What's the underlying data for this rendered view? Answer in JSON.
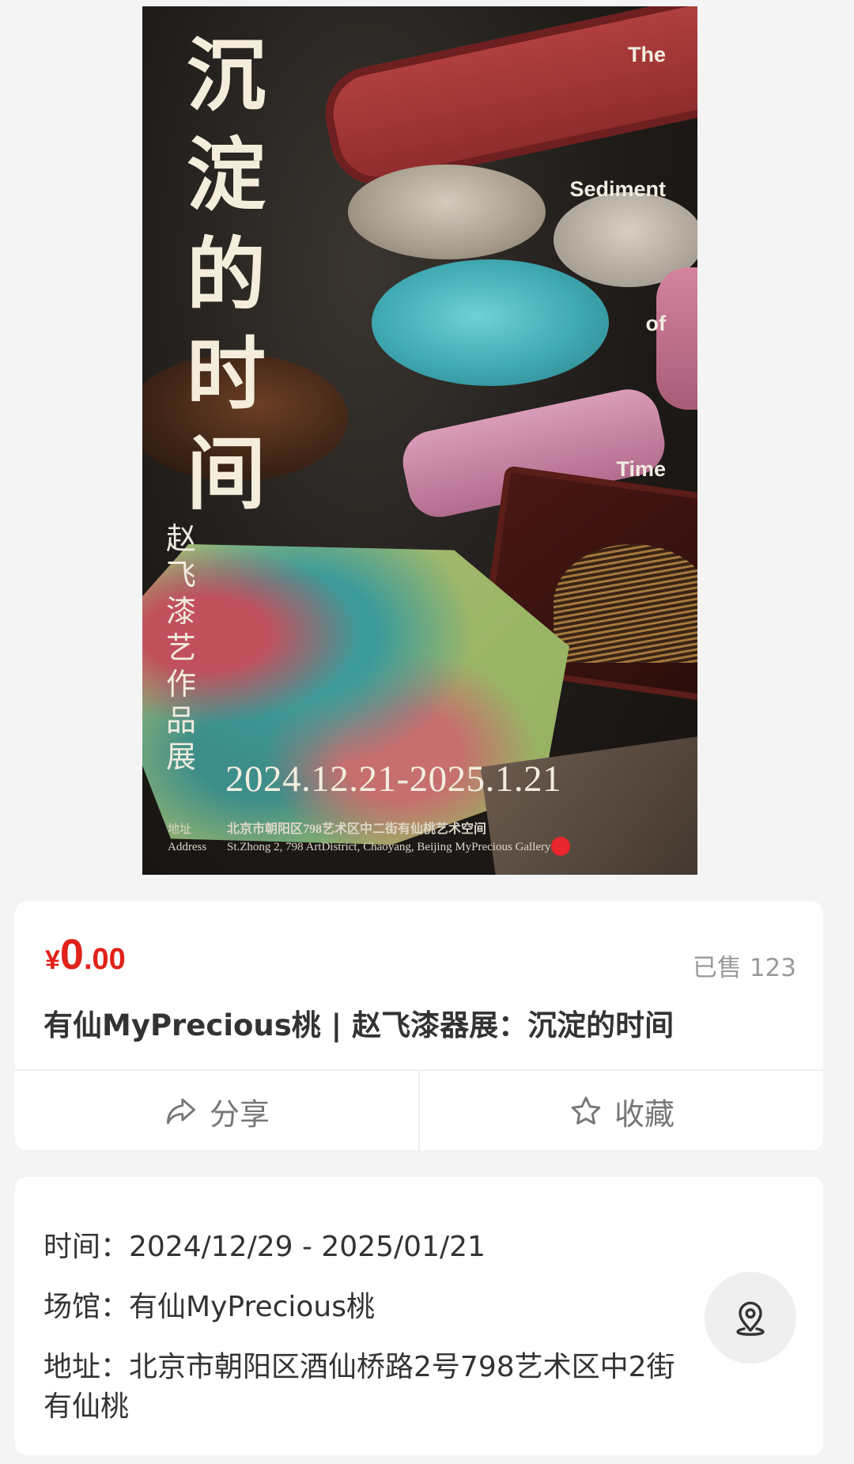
{
  "poster": {
    "title_cn": [
      "沉",
      "淀",
      "的",
      "时",
      "间"
    ],
    "title_en": [
      "The",
      "Sediment",
      "of",
      "Time"
    ],
    "artist": [
      "赵",
      "飞",
      "漆",
      "艺",
      "作",
      "品",
      "展"
    ],
    "dates": "2024.12.21-2025.1.21",
    "address_label_cn": "地址",
    "address_label_en": "Address",
    "address_cn": "北京市朝阳区798艺术区中二街有仙桃艺术空间",
    "address_en": "St.Zhong 2, 798 ArtDistrict, Chaoyang, Beijing  MyPrecious Gallery"
  },
  "product": {
    "price_currency": "¥",
    "price_integer": "0",
    "price_decimal": ".00",
    "sold_label": "已售",
    "sold_count": "123",
    "title": "有仙MyPrecious桃 | 赵飞漆器展：沉淀的时间",
    "accent_color": "#e0221a"
  },
  "actions": {
    "share_label": "分享",
    "share_icon": "share-icon",
    "favorite_label": "收藏",
    "favorite_icon": "star-icon"
  },
  "info": {
    "time_label": "时间：",
    "time_value": "2024/12/29 - 2025/01/21",
    "venue_label": "场馆：",
    "venue_value": "有仙MyPrecious桃",
    "address_label": "地址：",
    "address_value": "北京市朝阳区酒仙桥路2号798艺术区中2街有仙桃",
    "location_icon": "location-pin-icon"
  }
}
